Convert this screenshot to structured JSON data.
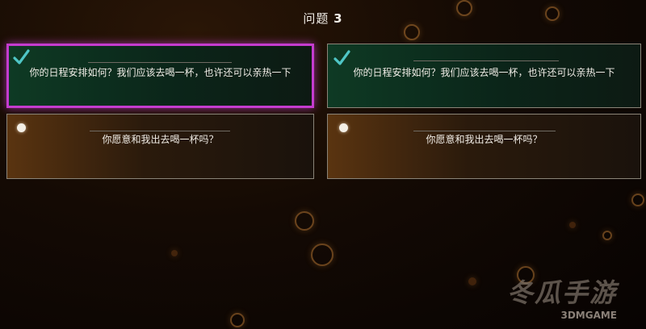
{
  "header": {
    "title_prefix": "问题",
    "question_number": "3"
  },
  "answers": [
    {
      "text": "你的日程安排如何？我们应该去喝一杯，也许还可以亲热一下",
      "status": "correct",
      "selected": true,
      "icon": "check-icon"
    },
    {
      "text": "你的日程安排如何？我们应该去喝一杯，也许还可以亲热一下",
      "status": "correct",
      "selected": false,
      "icon": "check-icon"
    },
    {
      "text": "你愿意和我出去喝一杯吗？",
      "status": "unanswered",
      "selected": false,
      "icon": "dot-icon"
    },
    {
      "text": "你愿意和我出去喝一杯吗？",
      "status": "unanswered",
      "selected": false,
      "icon": "dot-icon"
    }
  ],
  "watermark": {
    "top": "冬瓜手游",
    "bottom": "3DMGAME"
  },
  "colors": {
    "selected_border": "#c53ccf",
    "check": "#4fc6c6",
    "correct_bg": "#0e3a24",
    "neutral_bg": "#5a3410"
  }
}
